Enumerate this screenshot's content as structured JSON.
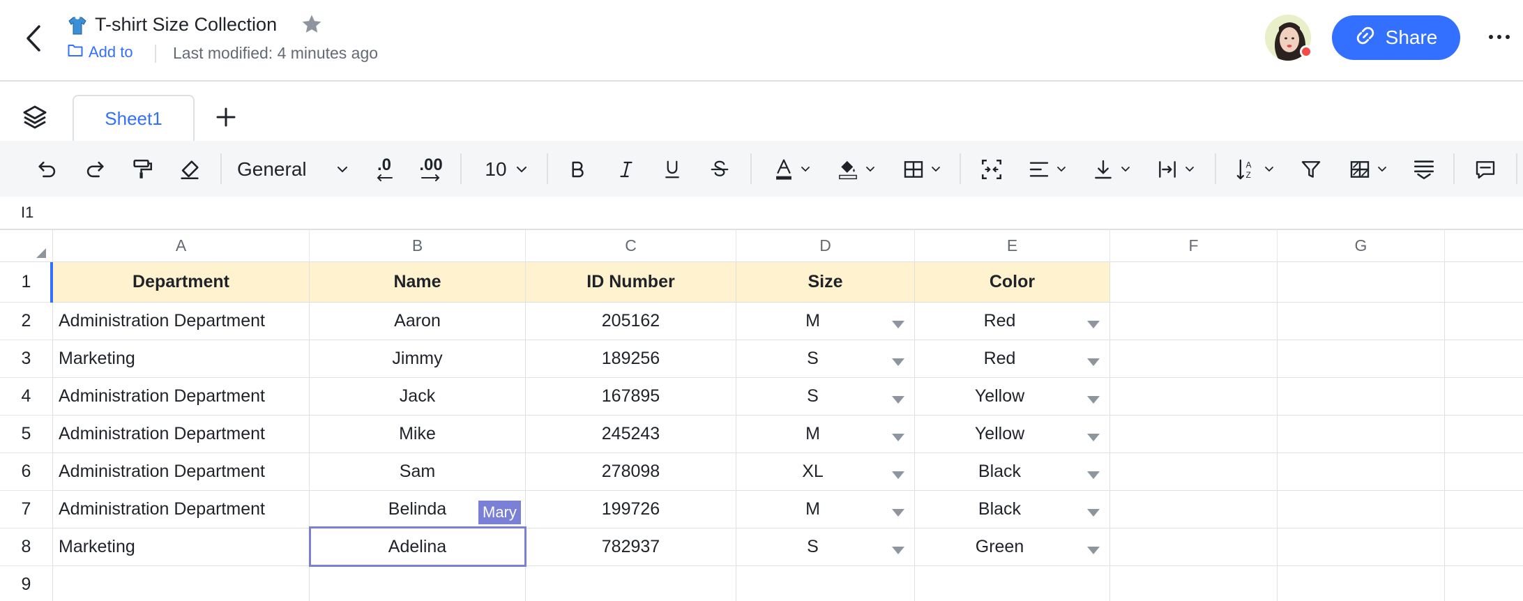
{
  "header": {
    "title": "T-shirt Size Collection",
    "add_to": "Add to",
    "last_modified": "Last modified: 4 minutes ago",
    "share_label": "Share"
  },
  "tabs": [
    {
      "label": "Sheet1",
      "active": true
    }
  ],
  "toolbar": {
    "number_format": "General",
    "decrease_decimal": ".0",
    "increase_decimal": ".00",
    "font_size": "10"
  },
  "formula_bar": {
    "cell_ref": "I1"
  },
  "columns": [
    "A",
    "B",
    "C",
    "D",
    "E",
    "F",
    "G"
  ],
  "rows": [
    "1",
    "2",
    "3",
    "4",
    "5",
    "6",
    "7",
    "8",
    "9"
  ],
  "table": {
    "headers": [
      "Department",
      "Name",
      "ID Number",
      "Size",
      "Color"
    ],
    "rows": [
      [
        "Administration Department",
        "Aaron",
        "205162",
        "M",
        "Red"
      ],
      [
        "Marketing",
        "Jimmy",
        "189256",
        "S",
        "Red"
      ],
      [
        "Administration Department",
        "Jack",
        "167895",
        "S",
        "Yellow"
      ],
      [
        "Administration Department",
        "Mike",
        "245243",
        "M",
        "Yellow"
      ],
      [
        "Administration Department",
        "Sam",
        "278098",
        "XL",
        "Black"
      ],
      [
        "Administration Department",
        "Belinda",
        "199726",
        "M",
        "Black"
      ],
      [
        "Marketing",
        "Adelina",
        "782937",
        "S",
        "Green"
      ]
    ]
  },
  "collaborator": {
    "name": "Mary"
  },
  "colors": {
    "accent": "#3370ff",
    "header_fill": "#fff2cf",
    "collaborator": "#7a80d6"
  }
}
